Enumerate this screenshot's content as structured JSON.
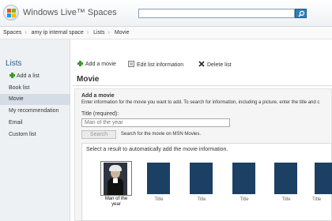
{
  "header": {
    "brand": "Windows Live™ Spaces",
    "search_placeholder": ""
  },
  "breadcrumb": [
    "Spaces",
    "amy ip internal space",
    "Lists",
    "Movie"
  ],
  "sidebar": {
    "title": "Lists",
    "add_label": "Add a list",
    "items": [
      "Book list",
      "Movie",
      "My recommendation",
      "Email",
      "Custom list"
    ],
    "active_index": 1
  },
  "toolbar": {
    "add_movie": "Add a movie",
    "edit_info": "Edit list information",
    "delete": "Delete list"
  },
  "main": {
    "title": "Movie",
    "panel_heading": "Add a movie",
    "panel_desc": "Enter information for the movie you want to add. To search for information, including a picture, enter the title and c",
    "title_label": "Title (required):",
    "title_placeholder": "Man of the year",
    "search_button": "Search",
    "search_note": "Search for the movie on MSN Movies.",
    "results_instruction": "Select a result to automatically add the movie information.",
    "results": [
      {
        "label": "Man of the year",
        "selected": true
      },
      {
        "label": "Title",
        "selected": false
      },
      {
        "label": "Title",
        "selected": false
      },
      {
        "label": "Title",
        "selected": false
      },
      {
        "label": "Title",
        "selected": false
      },
      {
        "label": "Title",
        "selected": false
      }
    ]
  },
  "colors": {
    "accent": "#2e5c8a",
    "thumb_placeholder": "#1c4063",
    "sidebar_bg": "#eef1f4",
    "sidebar_active": "#d4dde6"
  }
}
